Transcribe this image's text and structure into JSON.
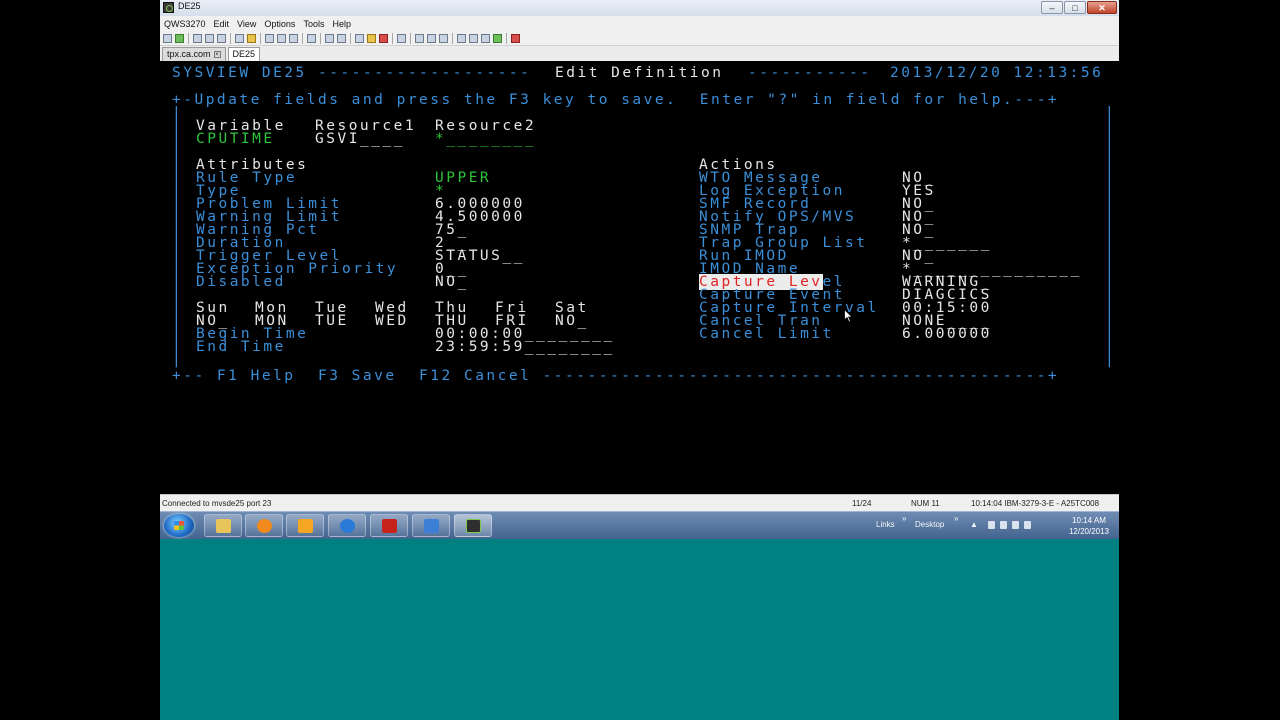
{
  "window": {
    "title": "DE25",
    "controls": {
      "minimize": "–",
      "maximize": "□",
      "close": "✕"
    }
  },
  "menu": [
    "QWS3270",
    "Edit",
    "View",
    "Options",
    "Tools",
    "Help"
  ],
  "tabs": [
    {
      "label": "tpx.ca.com",
      "close": "×"
    },
    {
      "label": "DE25"
    }
  ],
  "terminal": {
    "header_left": "SYSVIEW DE25 -------------------",
    "header_title": "Edit Definition",
    "header_dashes": "-----------",
    "header_datetime": "2013/12/20 12:13:56",
    "instructions": "+-Update fields and press the F3 key to save.  Enter \"?\" in field for help.---+",
    "border_char": "|",
    "key_headers": {
      "variable": "Variable",
      "resource1": "Resource1",
      "resource2": "Resource2"
    },
    "key_values": {
      "variable": "CPUTIME",
      "resource1": "GSVI____",
      "resource2": "*________"
    },
    "attributes_header": "Attributes",
    "actions_header": "Actions",
    "attributes": [
      {
        "label": "Rule Type",
        "value": "UPPER"
      },
      {
        "label": "Type",
        "value": "*"
      },
      {
        "label": "Problem Limit",
        "value": "6.000000"
      },
      {
        "label": "Warning Limit",
        "value": "4.500000"
      },
      {
        "label": "Warning Pct",
        "value": "75_"
      },
      {
        "label": "Duration",
        "value": "2___"
      },
      {
        "label": "Trigger Level",
        "value": "STATUS__"
      },
      {
        "label": "Exception Priority",
        "value": "0__"
      },
      {
        "label": "Disabled",
        "value": "NO_"
      }
    ],
    "actions": [
      {
        "label": "WTO Message",
        "value": "NO_"
      },
      {
        "label": "Log Exception",
        "value": "YES"
      },
      {
        "label": "SMF Record",
        "value": "NO_"
      },
      {
        "label": "Notify OPS/MVS",
        "value": "NO_"
      },
      {
        "label": "SNMP Trap",
        "value": "NO_"
      },
      {
        "label": "Trap Group List",
        "value": "*_______"
      },
      {
        "label": "Run IMOD",
        "value": "NO_"
      },
      {
        "label": "IMOD Name",
        "value": "*_______________"
      },
      {
        "label_highlight": "Capture Lev",
        "label_rest": "el",
        "value": "WARNING_"
      },
      {
        "label": "Capture Event",
        "value": "DIAGCICS"
      },
      {
        "label": "Capture Interval",
        "value": "00:15:00"
      },
      {
        "label": "Cancel Tran",
        "value": "NONE____"
      },
      {
        "label": "Cancel Limit",
        "value": "6.000000"
      }
    ],
    "days_header": [
      "Sun",
      "Mon",
      "Tue",
      "Wed",
      "Thu",
      "Fri",
      "Sat"
    ],
    "days_values": [
      "NO_",
      "MON",
      "TUE",
      "WED",
      "THU",
      "FRI",
      "NO_"
    ],
    "begin_time_label": "Begin Time",
    "begin_time_value": "00:00:00________",
    "end_time_label": "End Time",
    "end_time_value": "23:59:59________",
    "footer": "+-- F1 Help  F3 Save  F12 Cancel ---------------------------------------------+"
  },
  "status": {
    "connection": "Connected to mvsde25 port 23",
    "cursor": "11/24",
    "num": "NUM  11",
    "session": "10:14:04  IBM-3279-3-E - A25TC008"
  },
  "taskbar": {
    "links": "Links",
    "desktop": "Desktop",
    "chevron": "»",
    "time": "10:14 AM",
    "date": "12/20/2013"
  },
  "colors": {
    "terminal_bg": "#000000",
    "terminal_green": "#2ec43a",
    "terminal_blue": "#3b8fd8",
    "terminal_white": "#e6e6e6",
    "highlight_red": "#e02424",
    "desktop_teal": "#008080"
  }
}
